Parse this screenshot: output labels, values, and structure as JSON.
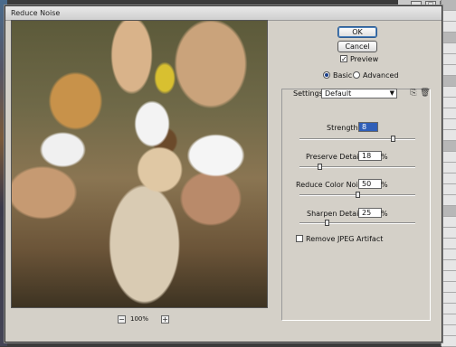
{
  "dialog": {
    "title": "Reduce Noise"
  },
  "buttons": {
    "ok": "OK",
    "cancel": "Cancel"
  },
  "preview": {
    "checkbox_label": "Preview",
    "checked": true
  },
  "mode": {
    "basic": "Basic",
    "advanced": "Advanced",
    "selected": "Basic"
  },
  "settings": {
    "label": "Settings:",
    "value": "Default"
  },
  "sliders": [
    {
      "label": "Strength:",
      "value": "8",
      "unit": "",
      "fraction": 0.8
    },
    {
      "label": "Preserve Details:",
      "value": "18",
      "unit": "%",
      "fraction": 0.18
    },
    {
      "label": "Reduce Color Noise:",
      "value": "50",
      "unit": "%",
      "fraction": 0.5
    },
    {
      "label": "Sharpen Details:",
      "value": "25",
      "unit": "%",
      "fraction": 0.25
    }
  ],
  "jpeg": {
    "label": "Remove JPEG Artifact",
    "checked": false
  },
  "zoom": {
    "value": "100%",
    "minus": "−",
    "plus": "+"
  }
}
